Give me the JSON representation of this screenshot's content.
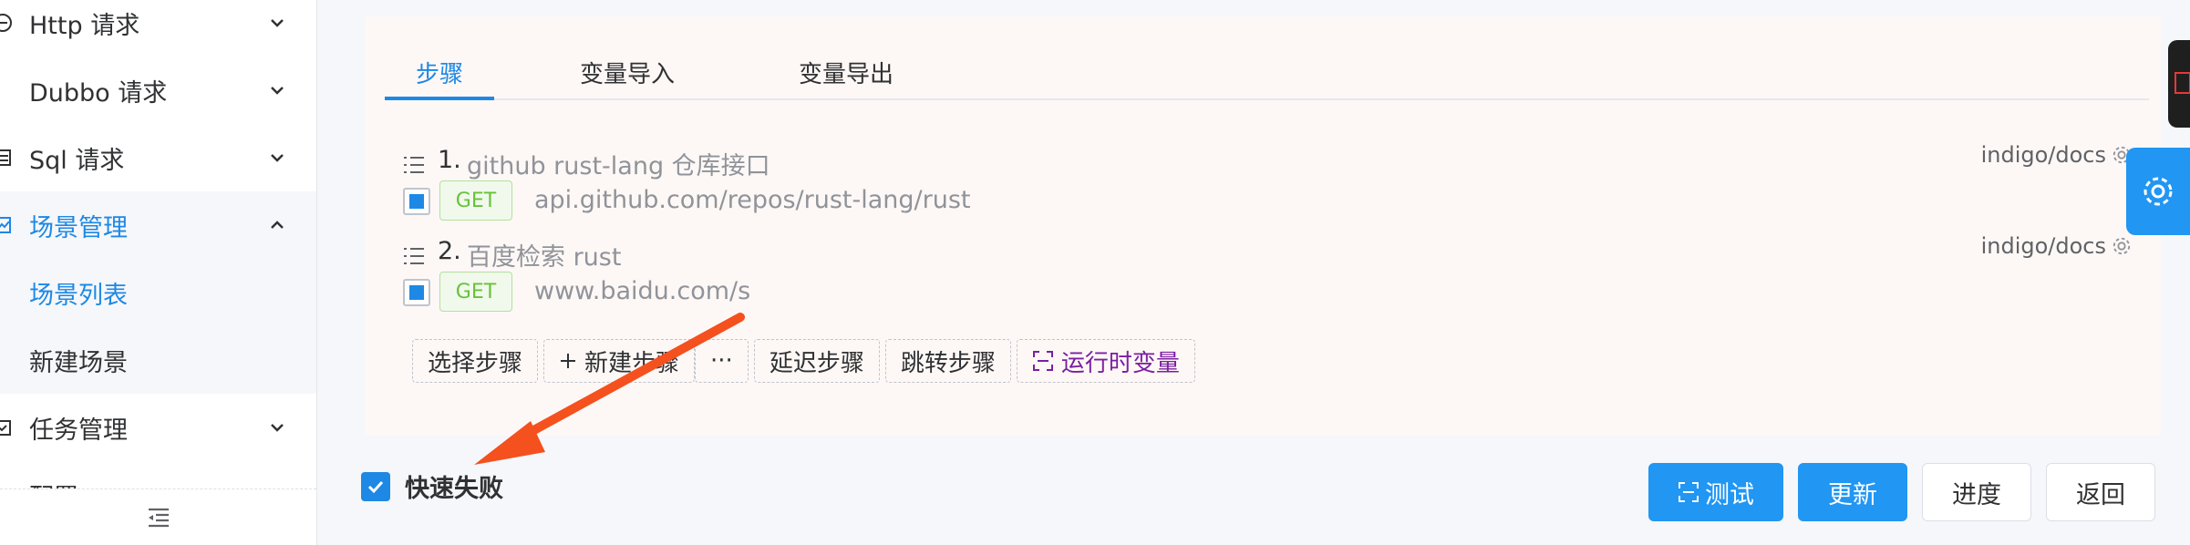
{
  "sidebar": {
    "items": [
      {
        "label": "Http 请求",
        "icon": "globe-icon",
        "chevron": "chevron-down-icon"
      },
      {
        "label": "Dubbo 请求",
        "icon": "",
        "chevron": "chevron-down-icon"
      },
      {
        "label": "Sql 请求",
        "icon": "calendar-icon",
        "chevron": "chevron-down-icon"
      },
      {
        "label": "场景管理",
        "icon": "chart-icon",
        "chevron": "chevron-up-icon"
      },
      {
        "label": "场景列表"
      },
      {
        "label": "新建场景"
      },
      {
        "label": "任务管理",
        "icon": "task-icon",
        "chevron": "chevron-down-icon"
      },
      {
        "label": "配置"
      }
    ],
    "collapse_icon": "menu-fold-icon"
  },
  "tabs": [
    {
      "label": "步骤"
    },
    {
      "label": "变量导入"
    },
    {
      "label": "变量导出"
    }
  ],
  "steps": [
    {
      "num": "1.",
      "title": "github rust-lang 仓库接口",
      "method": "GET",
      "url": "api.github.com/repos/rust-lang/rust",
      "repo": "indigo/docs"
    },
    {
      "num": "2.",
      "title": "百度检索 rust",
      "method": "GET",
      "url": "www.baidu.com/s",
      "repo": "indigo/docs"
    }
  ],
  "actions": {
    "select": "选择步骤",
    "new": "新建步骤",
    "more": "···",
    "delay": "延迟步骤",
    "jump": "跳转步骤",
    "runtime_var": "运行时变量"
  },
  "fast_fail": {
    "label": "快速失败",
    "checked": true
  },
  "buttons": {
    "test": "测试",
    "update": "更新",
    "progress": "进度",
    "back": "返回"
  },
  "colors": {
    "primary": "#2196f3",
    "active_text": "#1e88e5",
    "get_green": "#67c23a",
    "purple": "#7b1fa2",
    "arrow": "#f4511e"
  }
}
